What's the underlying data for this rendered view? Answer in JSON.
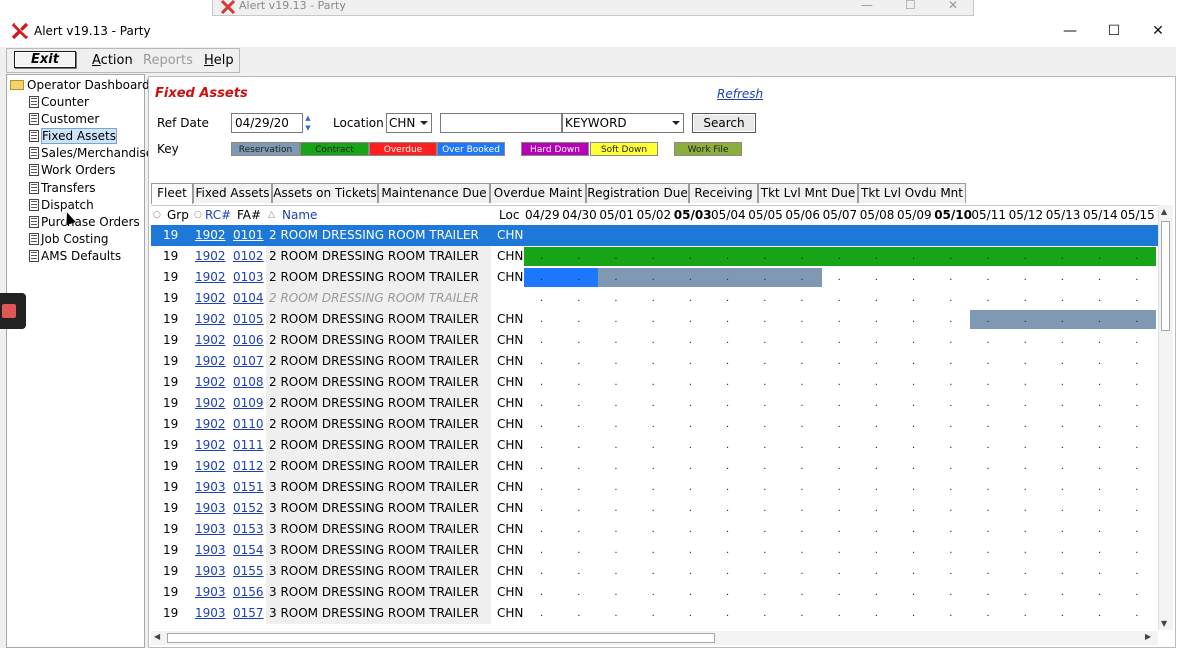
{
  "bg_window": {
    "title": "Alert v19.13 - Party"
  },
  "window": {
    "title": "Alert v19.13 - Party",
    "min": "—",
    "max": "☐",
    "close": "✕"
  },
  "menu": {
    "exit": "Exit",
    "action": "Action",
    "reports": "Reports",
    "help": "Help"
  },
  "tree": {
    "root": "Operator Dashboard",
    "items": [
      {
        "label": "Counter"
      },
      {
        "label": "Customer"
      },
      {
        "label": "Fixed Assets"
      },
      {
        "label": "Sales/Merchandise"
      },
      {
        "label": "Work Orders"
      },
      {
        "label": "Transfers"
      },
      {
        "label": "Dispatch"
      },
      {
        "label": "Purchase Orders"
      },
      {
        "label": "Job Costing"
      },
      {
        "label": "AMS Defaults"
      }
    ],
    "selected": "Fixed Assets"
  },
  "header": {
    "title": "Fixed Assets",
    "refresh": "Refresh"
  },
  "filters": {
    "ref_date_label": "Ref Date",
    "ref_date": "04/29/20",
    "location_label": "Location",
    "location": "CHN",
    "keyword_value": "",
    "keyword_type": "KEYWORD",
    "search": "Search",
    "key_label": "Key"
  },
  "key": [
    {
      "label": "Reservation",
      "color": "#7f99b3"
    },
    {
      "label": "Contract",
      "color": "#17a417"
    },
    {
      "label": "Overdue",
      "color": "#ff1f1f"
    },
    {
      "label": "Over Booked",
      "color": "#1e78ff"
    },
    {
      "label": "Hard Down",
      "color": "#b800b8"
    },
    {
      "label": "Soft Down",
      "color": "#ffff33"
    },
    {
      "label": "Work File",
      "color": "#8cae3c"
    }
  ],
  "tabs": [
    "Fleet",
    "Fixed Assets",
    "Assets on Tickets",
    "Maintenance Due",
    "Overdue Maint",
    "Registration Due",
    "Receiving",
    "Tkt Lvl Mnt Due",
    "Tkt Lvl Ovdu Mnt"
  ],
  "columns": {
    "grp": "Grp",
    "rc": "RC#",
    "fa": "FA#",
    "name": "Name",
    "loc": "Loc"
  },
  "dates": [
    "04/29",
    "04/30",
    "05/01",
    "05/02",
    "05/03",
    "05/04",
    "05/05",
    "05/06",
    "05/07",
    "05/08",
    "05/09",
    "05/10",
    "05/11",
    "05/12",
    "05/13",
    "05/14",
    "05/15"
  ],
  "bold_dates": [
    "05/03",
    "05/10"
  ],
  "rows": [
    {
      "grp": "19",
      "rc": "1902",
      "fa": "0101",
      "name": "2 ROOM DRESSING ROOM TRAILER",
      "loc": "CHN",
      "selected": true,
      "bars": []
    },
    {
      "grp": "19",
      "rc": "1902",
      "fa": "0102",
      "name": "2 ROOM DRESSING ROOM TRAILER",
      "loc": "CHN",
      "bars": [
        {
          "start": 0,
          "end": 17,
          "status": "Contract"
        }
      ]
    },
    {
      "grp": "19",
      "rc": "1902",
      "fa": "0103",
      "name": "2 ROOM DRESSING ROOM TRAILER",
      "loc": "CHN",
      "bars": [
        {
          "start": 0,
          "end": 2,
          "status": "Over Booked"
        },
        {
          "start": 2,
          "end": 8,
          "status": "Reservation"
        }
      ]
    },
    {
      "grp": "19",
      "rc": "1902",
      "fa": "0104",
      "name": "2 ROOM DRESSING ROOM TRAILER",
      "loc": "",
      "dimmed": true,
      "bars": []
    },
    {
      "grp": "19",
      "rc": "1902",
      "fa": "0105",
      "name": "2 ROOM DRESSING ROOM TRAILER",
      "loc": "CHN",
      "bars": [
        {
          "start": 12,
          "end": 17,
          "status": "Reservation"
        }
      ]
    },
    {
      "grp": "19",
      "rc": "1902",
      "fa": "0106",
      "name": "2 ROOM DRESSING ROOM TRAILER",
      "loc": "CHN",
      "bars": []
    },
    {
      "grp": "19",
      "rc": "1902",
      "fa": "0107",
      "name": "2 ROOM DRESSING ROOM TRAILER",
      "loc": "CHN",
      "bars": []
    },
    {
      "grp": "19",
      "rc": "1902",
      "fa": "0108",
      "name": "2 ROOM DRESSING ROOM TRAILER",
      "loc": "CHN",
      "bars": []
    },
    {
      "grp": "19",
      "rc": "1902",
      "fa": "0109",
      "name": "2 ROOM DRESSING ROOM TRAILER",
      "loc": "CHN",
      "bars": []
    },
    {
      "grp": "19",
      "rc": "1902",
      "fa": "0110",
      "name": "2 ROOM DRESSING ROOM TRAILER",
      "loc": "CHN",
      "bars": []
    },
    {
      "grp": "19",
      "rc": "1902",
      "fa": "0111",
      "name": "2 ROOM DRESSING ROOM TRAILER",
      "loc": "CHN",
      "bars": []
    },
    {
      "grp": "19",
      "rc": "1902",
      "fa": "0112",
      "name": "2 ROOM DRESSING ROOM TRAILER",
      "loc": "CHN",
      "bars": []
    },
    {
      "grp": "19",
      "rc": "1903",
      "fa": "0151",
      "name": "3 ROOM DRESSING ROOM TRAILER",
      "loc": "CHN",
      "bars": []
    },
    {
      "grp": "19",
      "rc": "1903",
      "fa": "0152",
      "name": "3 ROOM DRESSING ROOM TRAILER",
      "loc": "CHN",
      "bars": []
    },
    {
      "grp": "19",
      "rc": "1903",
      "fa": "0153",
      "name": "3 ROOM DRESSING ROOM TRAILER",
      "loc": "CHN",
      "bars": []
    },
    {
      "grp": "19",
      "rc": "1903",
      "fa": "0154",
      "name": "3 ROOM DRESSING ROOM TRAILER",
      "loc": "CHN",
      "bars": []
    },
    {
      "grp": "19",
      "rc": "1903",
      "fa": "0155",
      "name": "3 ROOM DRESSING ROOM TRAILER",
      "loc": "CHN",
      "bars": []
    },
    {
      "grp": "19",
      "rc": "1903",
      "fa": "0156",
      "name": "3 ROOM DRESSING ROOM TRAILER",
      "loc": "CHN",
      "bars": []
    },
    {
      "grp": "19",
      "rc": "1903",
      "fa": "0157",
      "name": "3 ROOM DRESSING ROOM TRAILER",
      "loc": "CHN",
      "bars": []
    }
  ]
}
